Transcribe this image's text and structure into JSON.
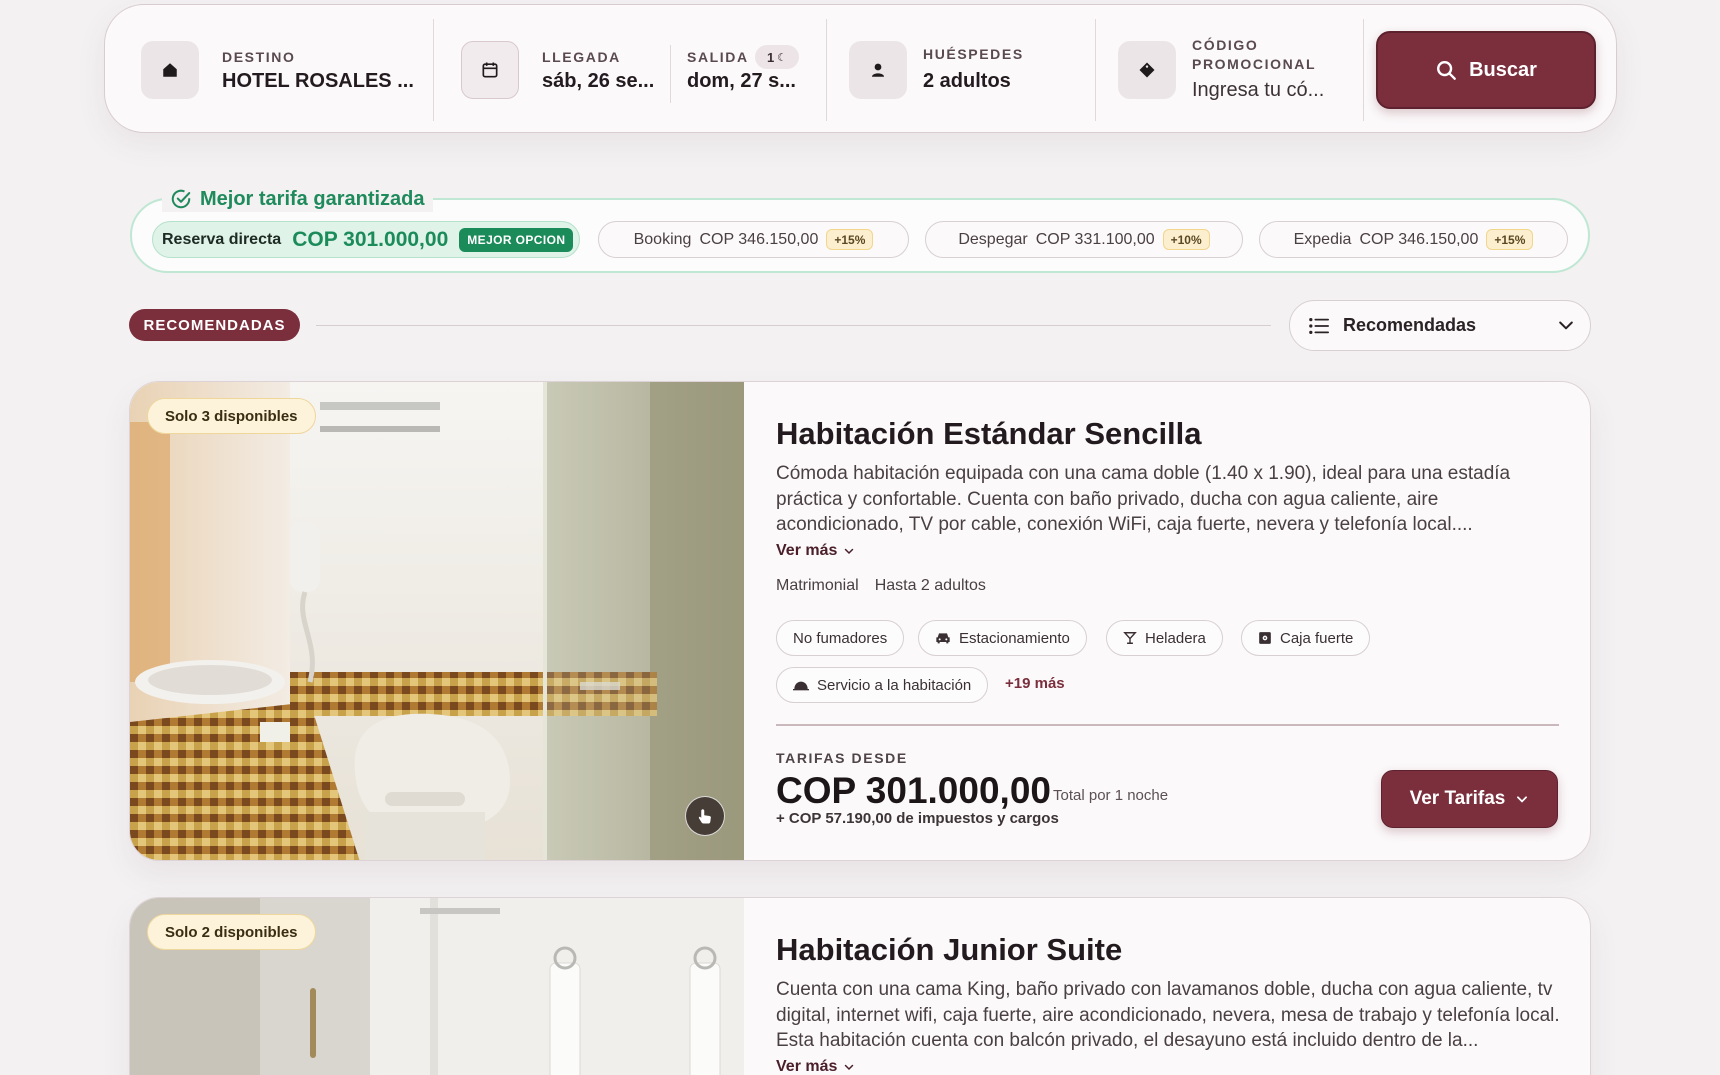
{
  "search": {
    "destination": {
      "label": "DESTINO",
      "value": "HOTEL ROSALES ...",
      "icon": "home-icon"
    },
    "checkin": {
      "label": "LLEGADA",
      "value": "sáb, 26 se...",
      "icon": "calendar-icon"
    },
    "checkout": {
      "label": "SALIDA",
      "value": "dom, 27 s...",
      "nights": "1"
    },
    "guests": {
      "label": "HUÉSPEDES",
      "value": "2 adultos",
      "icon": "user-icon"
    },
    "promo": {
      "label_line1": "CÓDIGO",
      "label_line2": "PROMOCIONAL",
      "placeholder": "Ingresa tu có...",
      "icon": "tag-icon"
    },
    "button_label": "Buscar"
  },
  "best_rate": {
    "title": "Mejor tarifa garantizada",
    "direct": {
      "label": "Reserva directa",
      "price": "COP 301.000,00",
      "badge": "MEJOR OPCION"
    },
    "competitors": [
      {
        "name": "Booking",
        "price": "COP 346.150,00",
        "diff": "+15%"
      },
      {
        "name": "Despegar",
        "price": "COP 331.100,00",
        "diff": "+10%"
      },
      {
        "name": "Expedia",
        "price": "COP 346.150,00",
        "diff": "+15%"
      }
    ],
    "colors": {
      "accent": "#1c8b5a",
      "badge_bg": "#fcefcf"
    }
  },
  "section": {
    "badge": "RECOMENDADAS",
    "sort_label": "Recomendadas"
  },
  "rooms": [
    {
      "availability": "Solo 3 disponibles",
      "title": "Habitación Estándar Sencilla",
      "description": "Cómoda habitación equipada con una cama doble (1.40 x 1.90), ideal para una estadía práctica y confortable. Cuenta con baño privado, ducha con agua caliente, aire acondicionado, TV por cable, conexión WiFi, caja fuerte, nevera y telefonía local....",
      "ver_mas": "Ver más",
      "bed": "Matrimonial",
      "capacity": "Hasta 2 adultos",
      "amenities": [
        "No fumadores",
        "Estacionamiento",
        "Heladera",
        "Caja fuerte",
        "Servicio a la habitación"
      ],
      "more_amenities": "+19 más",
      "rates_label": "TARIFAS DESDE",
      "price": "COP 301.000,00",
      "price_note": "Total por 1 noche",
      "taxes": "+ COP 57.190,00 de impuestos y cargos",
      "button_label": "Ver Tarifas"
    },
    {
      "availability": "Solo 2 disponibles",
      "title": "Habitación Junior Suite",
      "description": "Cuenta con una cama King, baño privado con lavamanos doble, ducha con agua caliente, tv digital, internet wifi, caja fuerte, aire acondicionado, nevera, mesa de trabajo y telefonía local. Esta habitación cuenta con balcón privado, el desayuno está incluido dentro de la...",
      "ver_mas": "Ver más"
    }
  ],
  "colors": {
    "brand": "#7b2f3d",
    "background": "#f3f1f2"
  }
}
